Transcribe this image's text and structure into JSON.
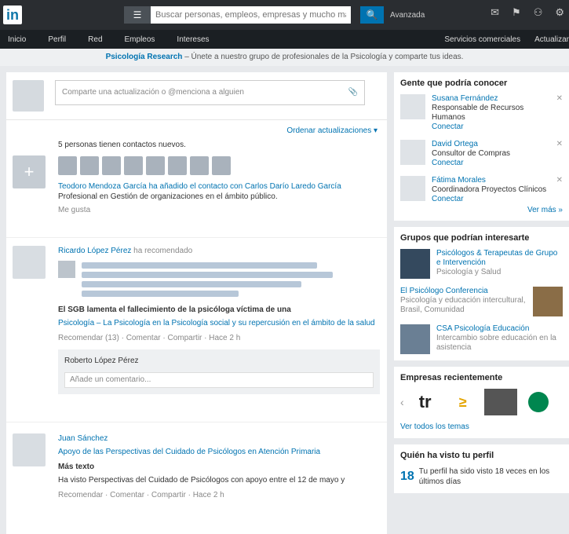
{
  "topbar": {
    "logo": "in",
    "search_category_icon": "list-icon",
    "search_placeholder": "Buscar personas, empleos, empresas y mucho más…",
    "search_button": "🔍",
    "advanced": "Avanzada",
    "icons": [
      "✉",
      "⚑",
      "⚇",
      "⚙"
    ]
  },
  "nav": {
    "items": [
      "Inicio",
      "Perfil",
      "Red",
      "Empleos",
      "Intereses"
    ],
    "right": [
      "Servicios comerciales",
      "Actualizar"
    ]
  },
  "banner": {
    "bold": "Psicología Research",
    "text": "– Únete a nuestro grupo de profesionales de la Psicología y comparte tus ideas."
  },
  "share": {
    "placeholder": "Comparte una actualización o @menciona a alguien",
    "clip_icon": "paperclip-icon"
  },
  "feed": {
    "settings": "Ordenar actualizaciones ▾",
    "item1": {
      "line1": "5 personas tienen contactos nuevos.",
      "line2": "Teodoro Mendoza García ha añadido el contacto con Carlos Darío Laredo García",
      "line3": "Profesional en Gestión de organizaciones en el ámbito público.",
      "action": "Me gusta"
    },
    "item2": {
      "author": "Ricardo López Pérez",
      "verb": "ha recomendado",
      "headline": "El SGB lamenta el fallecimiento de la psicóloga víctima de una",
      "detail": "Psicología – La Psicología en la Psicología social y su repercusión en el ámbito de la salud",
      "actions": "Recomendar (13) · Comentar · Compartir · Hace 2 h",
      "commenter": "Roberto López Pérez",
      "comment_placeholder": "Añade un comentario..."
    },
    "item3": {
      "author": "Juan Sánchez",
      "text": "Apoyo de las Perspectivas del Cuidado de Psicólogos en Atención Primaria",
      "sub": "Más texto",
      "body": "Ha visto Perspectivas del Cuidado de Psicólogos con apoyo entre el 12 de mayo y",
      "actions": "Recomendar · Comentar · Compartir · Hace 2 h"
    }
  },
  "right": {
    "pymk_title": "Gente que podría conocer",
    "pymk": [
      {
        "name": "Susana Fernández",
        "desc": "Responsable de Recursos Humanos",
        "connect": "Conectar"
      },
      {
        "name": "David Ortega",
        "desc": "Consultor de Compras",
        "connect": "Conectar"
      },
      {
        "name": "Fátima Morales",
        "desc": "Coordinadora Proyectos Clínicos",
        "connect": "Conectar"
      }
    ],
    "see_more": "Ver más »",
    "groups_title": "Grupos que podrían interesarte",
    "groups": [
      {
        "title": "Psicólogos & Terapeutas de Grupo e Intervención",
        "desc": "Psicología y Salud"
      },
      {
        "title": "El Psicólogo Conferencia",
        "desc": "Psicología y educación intercultural, Brasil, Comunidad"
      },
      {
        "title": "CSA Psicología Educación",
        "desc": "Intercambio sobre educación en la asistencia"
      }
    ],
    "companies_title": "Empresas recientemente",
    "companies_sub": "Ver todos los temas",
    "who_viewed_title": "Quién ha visto tu perfil",
    "views_count": "18",
    "views_text": "Tu perfil ha sido visto 18 veces en los últimos días"
  }
}
